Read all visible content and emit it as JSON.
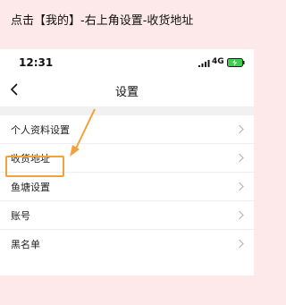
{
  "instruction": "点击【我的】-右上角设置-收货地址",
  "status_bar": {
    "time": "12:31",
    "network": "4G",
    "icons": [
      "signal-icon",
      "battery-icon"
    ]
  },
  "nav": {
    "title": "设置",
    "back_icon": "back-arrow-icon"
  },
  "settings": {
    "items": [
      {
        "label": "个人资料设置"
      },
      {
        "label": "收货地址"
      },
      {
        "label": "鱼塘设置"
      },
      {
        "label": "账号"
      },
      {
        "label": "黑名单"
      }
    ],
    "chevron_icon": "chevron-right-icon",
    "highlighted_item": "收货地址"
  },
  "colors": {
    "banner_bg": "#fde9e9",
    "highlight": "#f3a13a",
    "battery": "#3ccf4e"
  }
}
